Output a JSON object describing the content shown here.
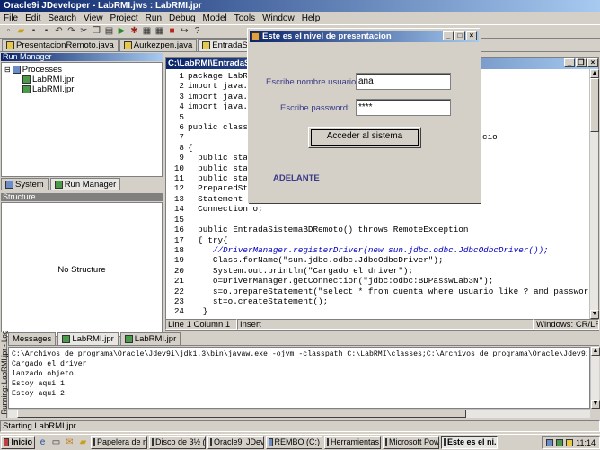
{
  "window": {
    "title": "Oracle9i JDeveloper - LabRMI.jws : LabRMI.jpr"
  },
  "menu": [
    "File",
    "Edit",
    "Search",
    "View",
    "Project",
    "Run",
    "Debug",
    "Model",
    "Tools",
    "Window",
    "Help"
  ],
  "toolbar_icons": [
    "new-icon",
    "open-icon",
    "save-icon",
    "save-all-icon",
    "undo-icon",
    "redo-icon",
    "cut-icon",
    "copy-icon",
    "paste-icon",
    "run-icon",
    "debug-icon",
    "make-icon",
    "rebuild-icon",
    "stop-icon",
    "step-icon",
    "help-icon"
  ],
  "editor_tabs": [
    {
      "label": "PresentacionRemoto.java"
    },
    {
      "label": "Aurkezpen.java"
    },
    {
      "label": "EntradaSistemaBDRemoto.java"
    }
  ],
  "run_manager": {
    "title": "Run Manager",
    "root": "Processes",
    "items": [
      "LabRMI.jpr",
      "LabRMI.jpr"
    ],
    "tabs": [
      "System",
      "Run Manager"
    ]
  },
  "structure": {
    "title": "Structure",
    "empty_text": "No Structure"
  },
  "editor": {
    "title": "C:\\LabRMI\\EntradaSis",
    "line_numbers": [
      "1",
      "2",
      "3",
      "4",
      "5",
      "6",
      "7",
      "8",
      "9",
      "10",
      "11",
      "12",
      "13",
      "14",
      "15",
      "16",
      "17",
      "18",
      "19",
      "20",
      "21",
      "22",
      "23",
      "24"
    ],
    "lines": [
      "package LabRMI;",
      "import java.rmi",
      "import java.rmi",
      "import java.sql",
      "",
      "public class En",
      "",
      "{",
      "  public static",
      "  public static",
      "  public static",
      "  PreparedState",
      "  Statement st;",
      "  Connection o;",
      "",
      "  public EntradaSistemaBDRemoto() throws RemoteException",
      "  { try{",
      "     //DriverManager.registerDriver(new sun.jdbc.odbc.JdbcOdbcDriver());",
      "     Class.forName(\"sun.jdbc.odbc.JdbcOdbcDriver\");",
      "     System.out.println(\"Cargado el driver\");",
      "     o=DriverManager.getConnection(\"jdbc:odbc:BDPasswLab3N\");",
      "     s=o.prepareStatement(\"select * from cuenta where usuario like ? and password=? and numIntentos",
      "     st=o.createStatement();",
      "   }"
    ],
    "right_fragment": "cio",
    "status": {
      "position": "Line 1 Column 1",
      "mode": "Insert",
      "encoding": "Windows: CR/LF"
    }
  },
  "dialog": {
    "title": "Este es el nivel de presentacion",
    "user_label": "Escribe nombre usuario:",
    "user_value": "ana",
    "password_label": "Escribe password:",
    "password_value": "****",
    "submit_label": "Acceder al sistema",
    "status_text": "ADELANTE"
  },
  "log": {
    "side_label": "Running: LabRMI.jpr - Log",
    "tabs": [
      "Messages",
      "LabRMI.jpr",
      "LabRMI.jpr"
    ],
    "lines": [
      "C:\\Archivos de programa\\Oracle\\Jdev9i\\jdk1.3\\bin\\javaw.exe -ojvm -classpath C:\\LabRMI\\classes;C:\\Archivos de programa\\Oracle\\Jdev9i\\jdev\\lib",
      "Cargado el driver",
      "lanzado objeto",
      "Estoy aqui 1",
      "Estoy aqui 2"
    ]
  },
  "status_bar": "Starting LabRMI.jpr.",
  "taskbar": {
    "start": "Inicio",
    "tasks": [
      "Papelera de r...",
      "Disco de 3½ (...",
      "Oracle9i JDev...",
      "REMBO (C:)",
      "Herramientas ...",
      "Microsoft Pow...",
      "Este es el ni..."
    ],
    "clock": "11:14"
  }
}
